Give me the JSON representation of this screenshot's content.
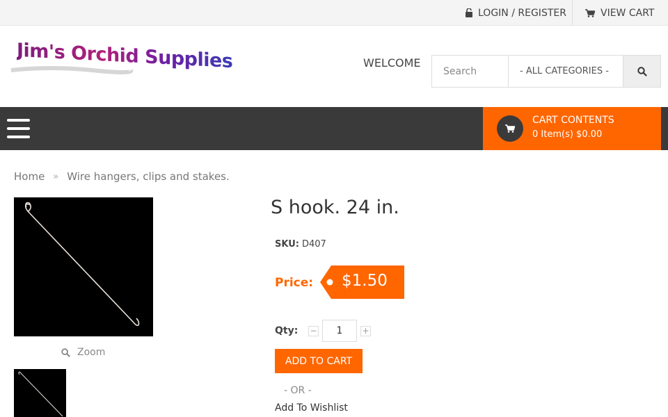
{
  "topbar": {
    "login_label": "LOGIN / REGISTER",
    "view_cart_label": "VIEW CART"
  },
  "header": {
    "logo_text": "Jim's Orchid Supplies",
    "welcome": "WELCOME",
    "search_placeholder": "Search",
    "category_selected": "- ALL CATEGORIES -"
  },
  "navbar": {
    "cart_title": "CART CONTENTS",
    "cart_summary": "0 Item(s) $0.00"
  },
  "breadcrumb": {
    "home": "Home",
    "separator": "»",
    "current": "Wire hangers, clips and stakes."
  },
  "product": {
    "title": "S hook. 24 in.",
    "sku_label": "SKU:",
    "sku": "D407",
    "price_label": "Price:",
    "price": "$1.50",
    "qty_label": "Qty:",
    "qty_value": "1",
    "qty_minus": "−",
    "qty_plus": "+",
    "add_to_cart": "ADD TO CART",
    "or_text": "- OR -",
    "wishlist": "Add To Wishlist",
    "zoom_label": "Zoom"
  },
  "colors": {
    "accent": "#ff6600",
    "nav_bg": "#3a3a3a",
    "topbar_bg": "#f4f4f4"
  },
  "icons": {
    "lock": "lock-icon",
    "cart": "cart-icon",
    "search": "search-icon",
    "menu": "hamburger-icon",
    "zoom": "zoom-icon"
  }
}
